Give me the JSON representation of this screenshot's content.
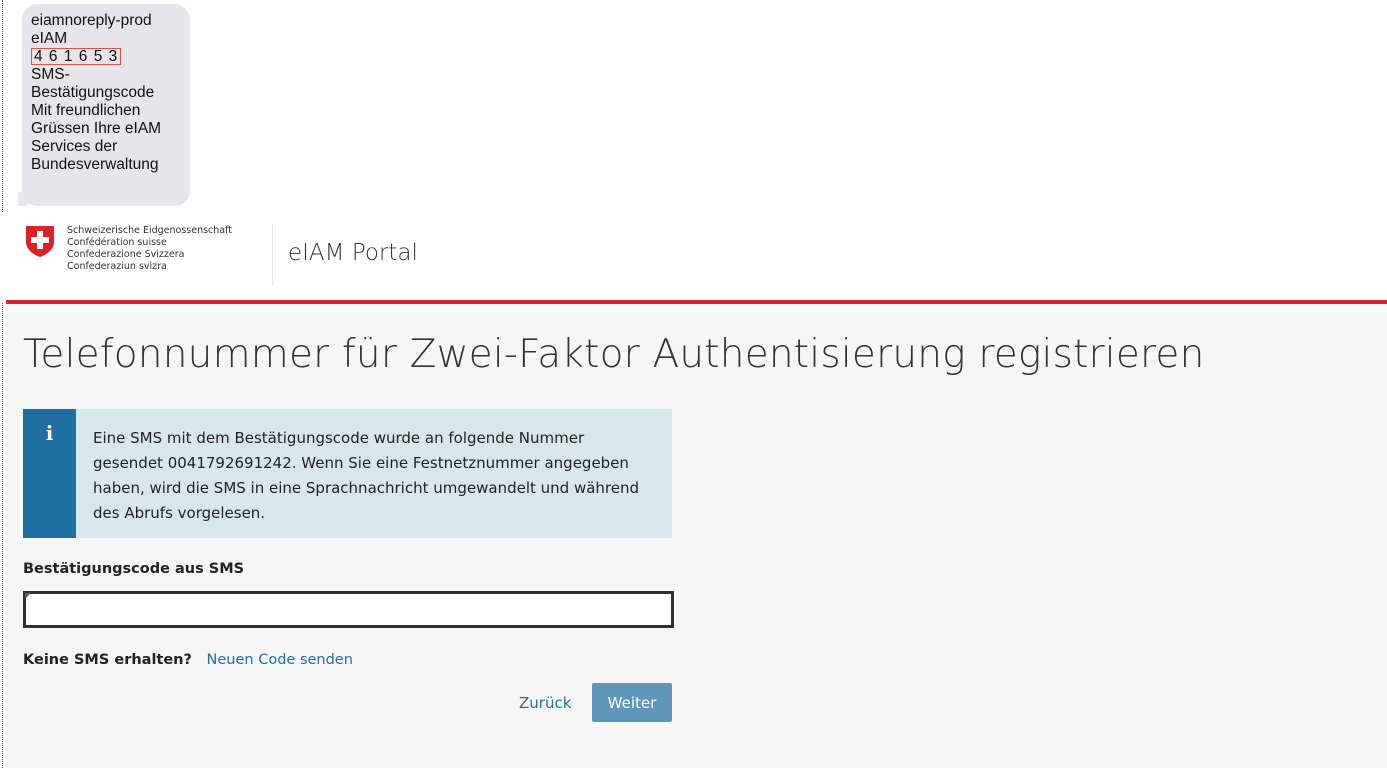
{
  "sms": {
    "lines": [
      "eiamnoreply-prod",
      "eIAM"
    ],
    "code": "4 6 1 6 5 3",
    "body_lines": [
      "SMS-",
      "Bestätigungscode",
      "Mit freundlichen",
      "Grüssen Ihre eIAM",
      "Services der",
      "Bundesverwaltung"
    ]
  },
  "header": {
    "confederation_lines": [
      "Schweizerische Eidgenossenschaft",
      "Confédération suisse",
      "Confederazione Svizzera",
      "Confederaziun svizra"
    ],
    "portal_title": "eIAM Portal",
    "flag_icon": "swiss-flag-icon",
    "accent_color": "#d8232a"
  },
  "main": {
    "title": "Telefonnummer für Zwei-Faktor Authentisierung registrieren",
    "info": {
      "icon": "info-icon",
      "icon_glyph": "i",
      "text": "Eine SMS mit dem Bestätigungscode wurde an folgende Nummer gesendet 0041792691242. Wenn Sie eine Festnetznummer angegeben haben, wird die SMS in eine Sprachnachricht umgewandelt und während des Abrufs vorgelesen."
    },
    "code_field": {
      "label": "Bestätigungscode aus SMS",
      "value": "",
      "placeholder": ""
    },
    "resend": {
      "label": "Keine SMS erhalten?",
      "link": "Neuen Code senden"
    },
    "actions": {
      "back_label": "Zurück",
      "next_label": "Weiter",
      "primary_color": "#5f97bb",
      "link_color": "#1f6fa5"
    }
  }
}
